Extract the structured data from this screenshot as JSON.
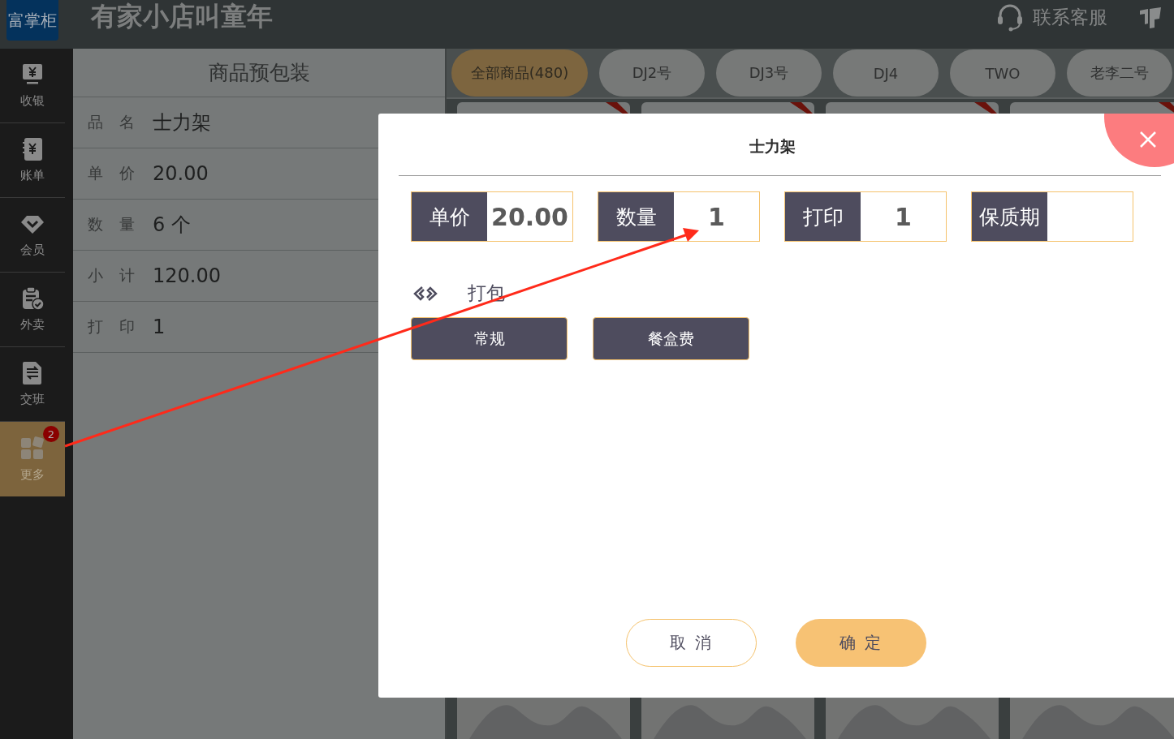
{
  "app": {
    "logo": "富掌柜",
    "shop_name": "有家小店叫童年",
    "support_link": "联系客服"
  },
  "sidebar": {
    "items": [
      {
        "label": "收银",
        "kind": "register",
        "selected": false
      },
      {
        "label": "账单",
        "kind": "bill",
        "selected": false
      },
      {
        "label": "会员",
        "kind": "member",
        "selected": false
      },
      {
        "label": "外卖",
        "kind": "delivery",
        "selected": false
      },
      {
        "label": "交班",
        "kind": "shift",
        "selected": false
      },
      {
        "label": "更多",
        "kind": "more",
        "selected": true,
        "badge": "2"
      }
    ]
  },
  "package_panel": {
    "title": "商品预包装",
    "fields": [
      {
        "label": "品 名",
        "value": "士力架"
      },
      {
        "label": "单 价",
        "value": "20.00"
      },
      {
        "label": "数 量",
        "value": "6 个"
      },
      {
        "label": "小 计",
        "value": "120.00"
      },
      {
        "label": "打 印",
        "value": "1"
      }
    ]
  },
  "category_tabs": [
    {
      "label": "全部商品(480)",
      "selected": true
    },
    {
      "label": "DJ2号",
      "selected": false
    },
    {
      "label": "DJ3号",
      "selected": false
    },
    {
      "label": "DJ4",
      "selected": false
    },
    {
      "label": "TWO",
      "selected": false
    },
    {
      "label": "老李二号",
      "selected": false
    }
  ],
  "dialog": {
    "title": "士力架",
    "fields": [
      {
        "label": "单价",
        "value": "20.00"
      },
      {
        "label": "数量",
        "value": "1"
      },
      {
        "label": "打印",
        "value": "1"
      },
      {
        "label": "保质期"
      }
    ],
    "section_label": "打包",
    "options": [
      {
        "label": "常规"
      },
      {
        "label": "餐盒费"
      }
    ],
    "buttons": [
      {
        "label": "取 消",
        "kind": "secondary"
      },
      {
        "label": "确 定",
        "kind": "primary"
      }
    ]
  }
}
